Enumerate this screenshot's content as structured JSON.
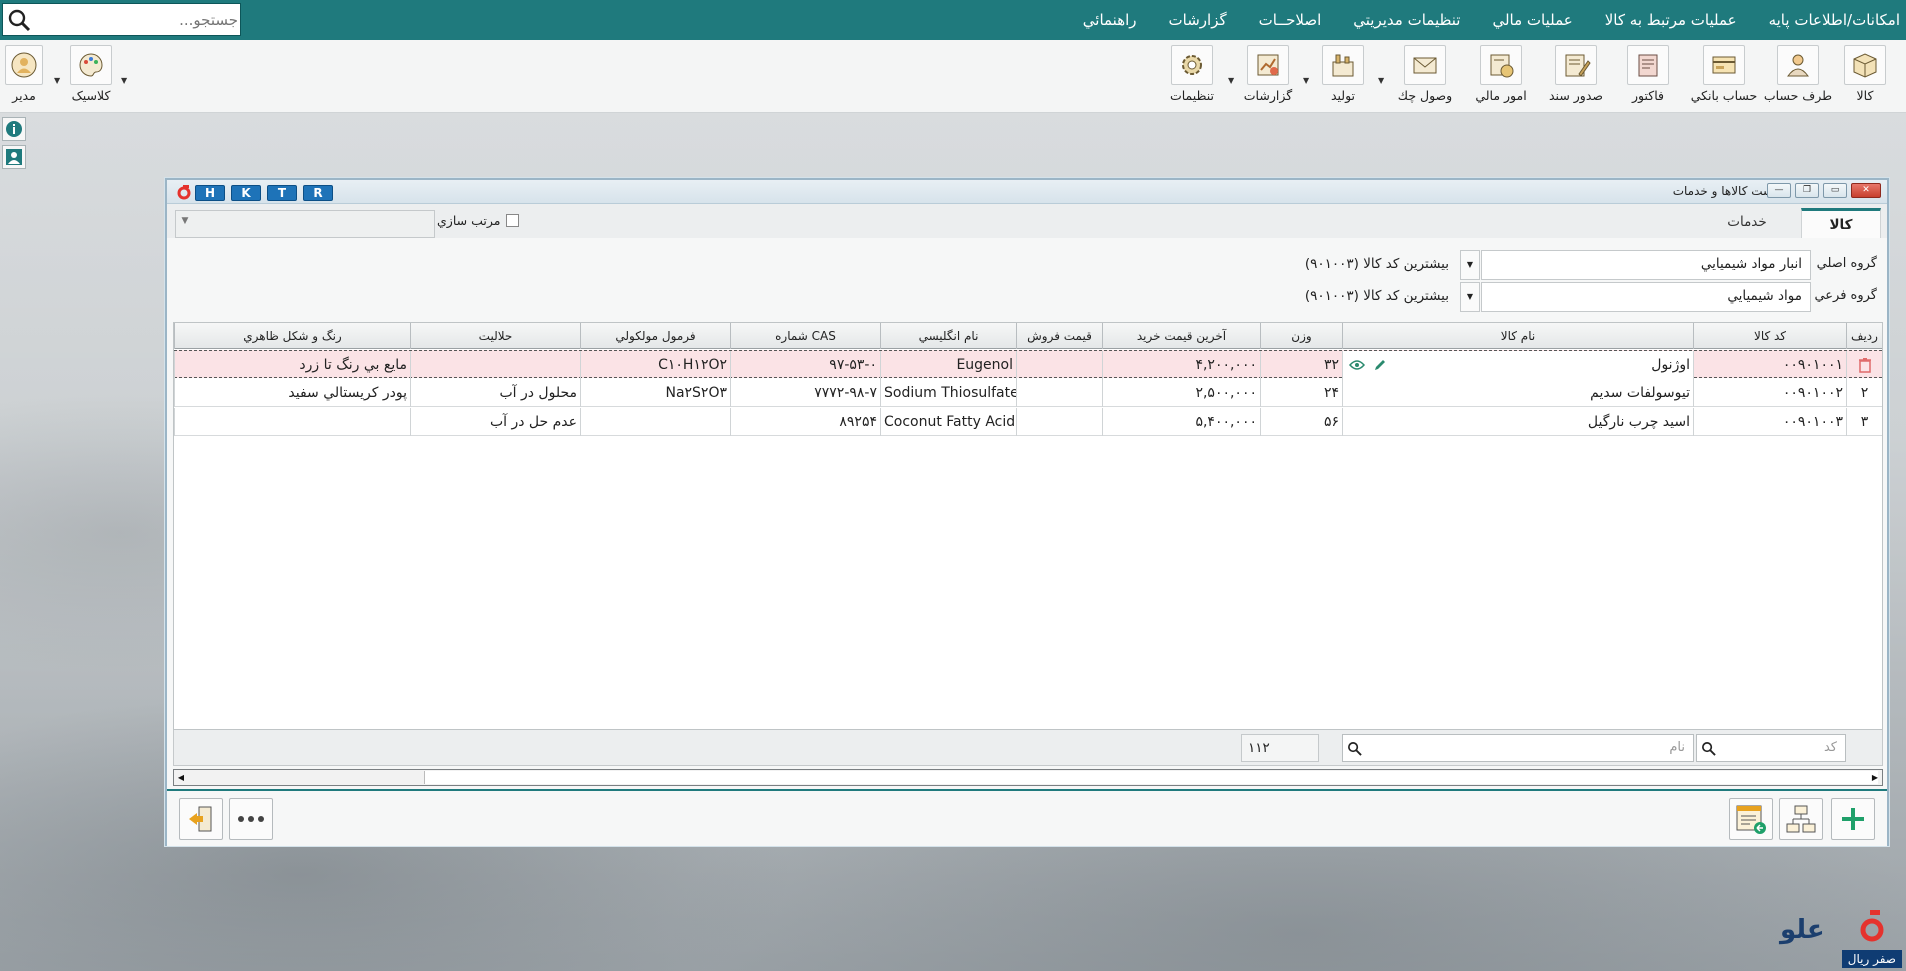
{
  "menubar": {
    "items": [
      "امکانات/اطلاعات پايه",
      "عمليات مرتبط به کالا",
      "عمليات مالي",
      "تنظيمات مديريتي",
      "اصلاحــات",
      "گزارشات",
      "راهنمائي"
    ],
    "search_placeholder": "جستجو...",
    "bg_color": "#1f7a7d"
  },
  "toolbar": {
    "buttons": [
      {
        "label": "کالا",
        "icon": "box-icon"
      },
      {
        "label": "طرف حساب",
        "icon": "person-card-icon"
      },
      {
        "label": "حساب بانکي",
        "icon": "bank-card-icon"
      },
      {
        "label": "فاکتور",
        "icon": "invoice-icon"
      },
      {
        "label": "صدور سند",
        "icon": "document-pen-icon"
      },
      {
        "label": "امور مالي",
        "icon": "finance-icon"
      },
      {
        "label": "وصول چك",
        "icon": "envelope-icon"
      },
      {
        "label": "توليد",
        "icon": "factory-icon"
      },
      {
        "label": "گزارشات",
        "icon": "report-chart-icon"
      },
      {
        "label": "تنظيمات",
        "icon": "gear-icon"
      }
    ],
    "left_buttons": [
      {
        "label": "کلاسيک",
        "icon": "palette-icon"
      },
      {
        "label": "مدير",
        "icon": "user-avatar-icon"
      }
    ]
  },
  "window": {
    "title": "ليست کالاها و خدمات",
    "hotkeys": [
      "H",
      "K",
      "T",
      "R"
    ],
    "tabs": [
      "کالا",
      "خدمات"
    ],
    "sort_label": "مرتب سازي",
    "filters": [
      {
        "label": "گروه اصلي",
        "value": "انبار مواد شيميايي",
        "max": "بيشترين کد کالا (۹۰۱۰۰۳)"
      },
      {
        "label": "گروه فرعي",
        "value": "مواد شيميايي",
        "max": "بيشترين کد کالا (۹۰۱۰۰۳)"
      }
    ],
    "columns": [
      "رديف",
      "کد کالا",
      "نام کالا",
      "وزن",
      "آخرين قيمت خريد",
      "قيمت فروش",
      "نام انگليسي",
      "CAS شماره",
      "فرمول مولکولي",
      "حلاليت",
      "رنگ و شکل ظاهري"
    ],
    "rows": [
      {
        "idx": "",
        "code": "۰۰۹۰۱۰۰۱",
        "name": "اوژنول",
        "weight": "۳۲",
        "last_price": "۴,۲۰۰,۰۰۰",
        "sale_price": "",
        "english": "Eugenol",
        "cas": "۹۷-۵۳-۰",
        "formula": "C۱۰H۱۲O۲",
        "solubility": "",
        "appearance": "مايع بي رنگ تا زرد"
      },
      {
        "idx": "۲",
        "code": "۰۰۹۰۱۰۰۲",
        "name": "تيوسولفات سديم",
        "weight": "۲۴",
        "last_price": "۲,۵۰۰,۰۰۰",
        "sale_price": "",
        "english": "Sodium Thiosulfate",
        "cas": "۷۷۷۲-۹۸-۷",
        "formula": "Na۲S۲O۳",
        "solubility": "محلول در آب",
        "appearance": "پودر کريستالي سفيد"
      },
      {
        "idx": "۳",
        "code": "۰۰۹۰۱۰۰۳",
        "name": "اسيد چرب نارگيل",
        "weight": "۵۶",
        "last_price": "۵,۴۰۰,۰۰۰",
        "sale_price": "",
        "english": "Coconut Fatty Acid",
        "cas": "۸۹۲۵۴",
        "formula": "",
        "solubility": "عدم حل در آب",
        "appearance": ""
      }
    ],
    "footer": {
      "count": "۱۱۲",
      "name_placeholder": "نام",
      "code_placeholder": "کد"
    }
  },
  "brand": {
    "text": "صفر ريال"
  }
}
